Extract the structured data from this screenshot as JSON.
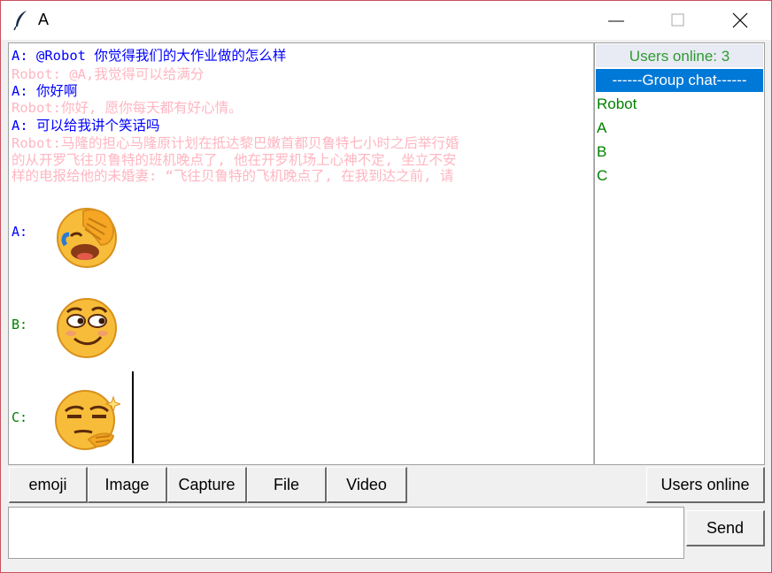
{
  "window": {
    "title": "A"
  },
  "chat": {
    "messages": [
      {
        "text": "A: @Robot 你觉得我们的大作业做的怎么样",
        "color": "blue"
      },
      {
        "text": "Robot: @A,我觉得可以给满分",
        "color": "pink"
      },
      {
        "text": "A: 你好啊",
        "color": "blue"
      },
      {
        "text": "Robot:你好, 愿你每天都有好心情。",
        "color": "pink"
      },
      {
        "text": "A: 可以给我讲个笑话吗",
        "color": "blue"
      },
      {
        "text": "Robot:马隆的担心马隆原计划在抵达黎巴嫩首都贝鲁特七小时之后举行婚",
        "color": "pink"
      },
      {
        "text": "的从开罗飞往贝鲁特的班机晚点了, 他在开罗机场上心神不定, 坐立不安",
        "color": "pink"
      },
      {
        "text": "样的电报给他的未婚妻: “飞往贝鲁特的飞机晚点了, 在我到达之前, 请",
        "color": "pink"
      }
    ],
    "emoji_posts": [
      {
        "sender": "A:",
        "emoji": "facepalm-laugh-emoji",
        "color": "blue"
      },
      {
        "sender": "B:",
        "emoji": "smirk-emoji",
        "color": "green"
      },
      {
        "sender": "C:",
        "emoji": "thinking-cool-emoji",
        "color": "green"
      }
    ]
  },
  "sidebar": {
    "header": "Users online: 3",
    "items": [
      {
        "label": "------Group chat------",
        "selected": true
      },
      {
        "label": "Robot",
        "selected": false
      },
      {
        "label": "A",
        "selected": false
      },
      {
        "label": "B",
        "selected": false
      },
      {
        "label": "C",
        "selected": false
      }
    ]
  },
  "toolbar": {
    "emoji": "emoji",
    "image": "Image",
    "capture": "Capture",
    "file": "File",
    "video": "Video",
    "users_online": "Users online"
  },
  "composer": {
    "value": "",
    "send": "Send"
  },
  "colors": {
    "blue": "#0000ff",
    "pink": "#ffb6c1",
    "green": "#008000",
    "selection": "#0078d7",
    "online_header": "#2e9a2e"
  }
}
